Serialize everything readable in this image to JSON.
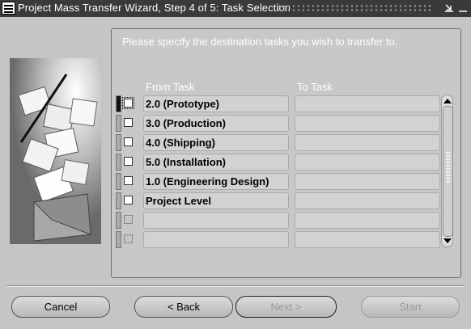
{
  "window": {
    "title": "Project Mass Transfer Wizard, Step 4 of 5: Task Selection",
    "app_icon": "oracle-forms-icon",
    "controls": [
      "minimize-icon",
      "close-icon"
    ]
  },
  "instruction": "Please specify the destination tasks you wish to transfer to.",
  "columns": {
    "from": "From Task",
    "to": "To Task"
  },
  "rows": [
    {
      "from": "2.0 (Prototype)",
      "to": "",
      "checked": false
    },
    {
      "from": "3.0 (Production)",
      "to": "",
      "checked": false
    },
    {
      "from": "4.0 (Shipping)",
      "to": "",
      "checked": false
    },
    {
      "from": "5.0 (Installation)",
      "to": "",
      "checked": false
    },
    {
      "from": "1.0 (Engineering Design)",
      "to": "",
      "checked": false
    },
    {
      "from": "Project Level",
      "to": "",
      "checked": false
    },
    {
      "from": "",
      "to": "",
      "checked": false
    },
    {
      "from": "",
      "to": "",
      "checked": false
    }
  ],
  "buttons": {
    "cancel": "Cancel",
    "back": "< Back",
    "next": "Next >",
    "start": "Start"
  },
  "colors": {
    "titlebar": "#3a3a3a",
    "background": "#c5c5c5",
    "field": "#d2d2d2"
  }
}
